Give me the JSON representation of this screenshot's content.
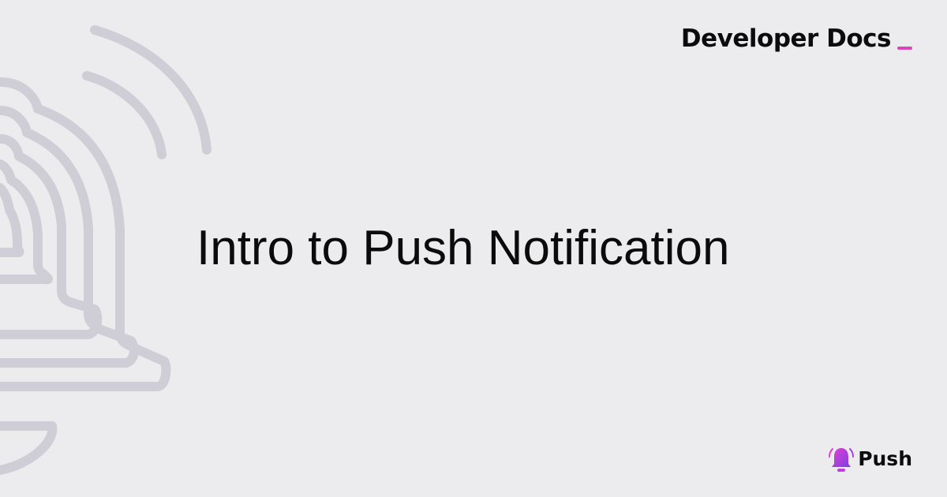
{
  "header": {
    "docs_label": "Developer Docs"
  },
  "main": {
    "title": "Intro to Push Notification"
  },
  "brand": {
    "name": "Push",
    "icon": "bell-icon"
  },
  "colors": {
    "background": "#ececef",
    "accent": "#dd44b9",
    "outline": "#cfced6",
    "text": "#0b0b0b"
  },
  "decoration": {
    "icon": "bell-outline-icon"
  }
}
